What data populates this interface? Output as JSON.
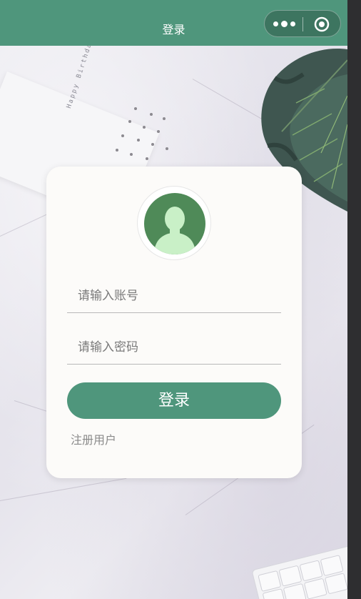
{
  "navbar": {
    "title": "登录",
    "color": "#4f967c"
  },
  "capsule": {
    "more_icon": "more-dots-icon",
    "close_icon": "target-circle-icon"
  },
  "decor": {
    "card_text": "Happy Birthday to you"
  },
  "login": {
    "account_placeholder": "请输入账号",
    "password_placeholder": "请输入密码",
    "submit_label": "登录",
    "register_label": "注册用户",
    "avatar_icon": "user-avatar-icon"
  },
  "colors": {
    "accent": "#4f967c",
    "card": "#fcfbf9",
    "avatar_bg": "#4f8a58",
    "avatar_figure": "#c9f0c7"
  }
}
